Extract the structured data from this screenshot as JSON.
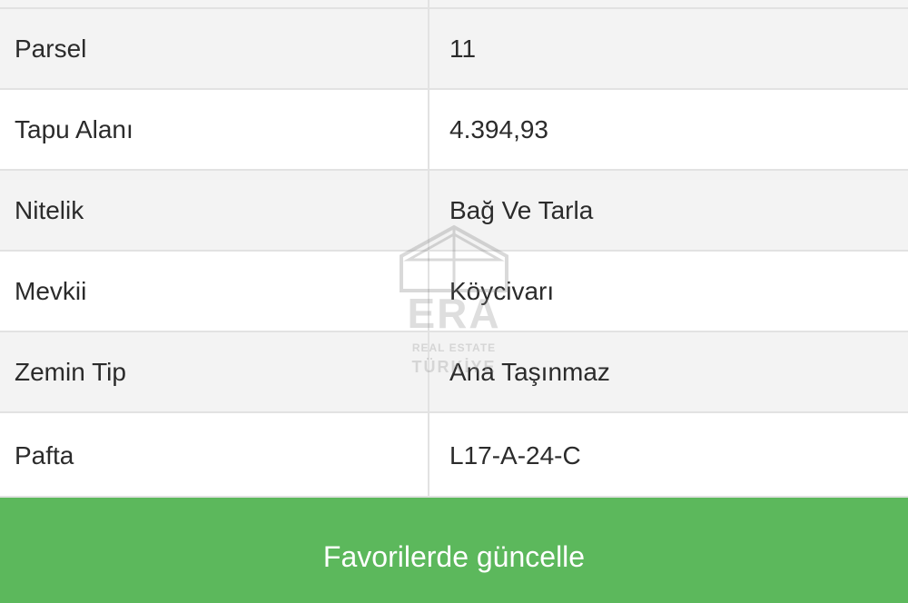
{
  "details": {
    "rows": [
      {
        "key": "Parsel",
        "value": "11"
      },
      {
        "key": "Tapu Alanı",
        "value": "4.394,93"
      },
      {
        "key": "Nitelik",
        "value": "Bağ Ve Tarla"
      },
      {
        "key": "Mevkii",
        "value": "Köycivarı"
      },
      {
        "key": "Zemin Tip",
        "value": "Ana Taşınmaz"
      },
      {
        "key": "Pafta",
        "value": "L17-A-24-C"
      }
    ]
  },
  "actions": {
    "favorite_label": "Favorilerde güncelle"
  },
  "watermark": {
    "brand": "ERA",
    "line1": "REAL ESTATE",
    "line2": "TÜRKİYE"
  },
  "colors": {
    "button_green": "#5cb85c",
    "row_shade": "#f3f3f3",
    "border": "#e2e2e2"
  }
}
